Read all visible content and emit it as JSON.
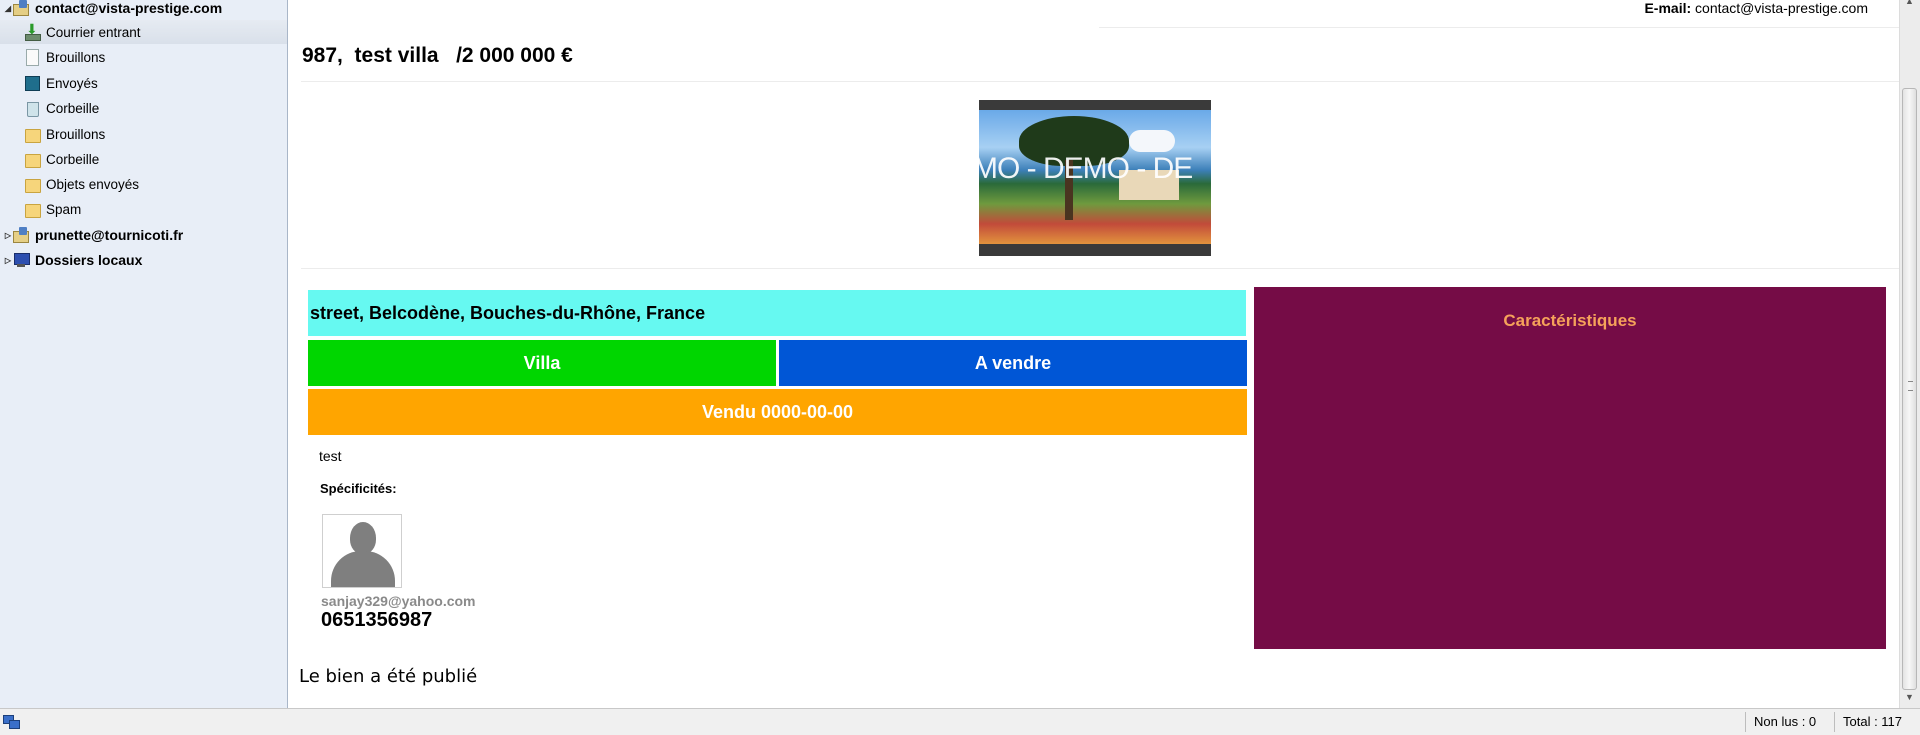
{
  "sidebar": {
    "accounts": [
      {
        "name": "contact@vista-prestige.com",
        "expanded": true,
        "folders": [
          {
            "label": "Courrier entrant",
            "icon": "inbox-icon",
            "selected": true
          },
          {
            "label": "Brouillons",
            "icon": "drafts-icon"
          },
          {
            "label": "Envoyés",
            "icon": "sent-icon"
          },
          {
            "label": "Corbeille",
            "icon": "trash-icon"
          },
          {
            "label": "Brouillons",
            "icon": "folder-icon"
          },
          {
            "label": "Corbeille",
            "icon": "folder-icon"
          },
          {
            "label": "Objets envoyés",
            "icon": "folder-icon"
          },
          {
            "label": "Spam",
            "icon": "folder-icon"
          }
        ]
      },
      {
        "name": "prunette@tournicoti.fr",
        "expanded": false
      },
      {
        "name": "Dossiers locaux",
        "expanded": false
      }
    ]
  },
  "message": {
    "email_label": "E-mail:",
    "email_value": "contact@vista-prestige.com",
    "title": "987,  test villa   /2 000 000 €",
    "image_watermark": "MO - DEMO - DE",
    "address": "street, Belcodène, Bouches-du-Rhône, France",
    "property_type": "Villa",
    "listing_status": "A vendre",
    "sold_label": "Vendu 0000-00-00",
    "description": "test",
    "specifics_label": "Spécificités:",
    "agent_email": "sanjay329@yahoo.com",
    "agent_phone": "0651356987",
    "features_title": "Caractéristiques",
    "published_note": "Le bien a été publié"
  },
  "statusbar": {
    "unread": "Non lus : 0",
    "total": "Total : 117"
  },
  "colors": {
    "address_bg": "#66f9f1",
    "type_bg": "#00d600",
    "status_bg": "#0056d6",
    "sold_bg": "#ffa500",
    "features_bg": "#750c46",
    "features_title": "#f5a25a"
  }
}
